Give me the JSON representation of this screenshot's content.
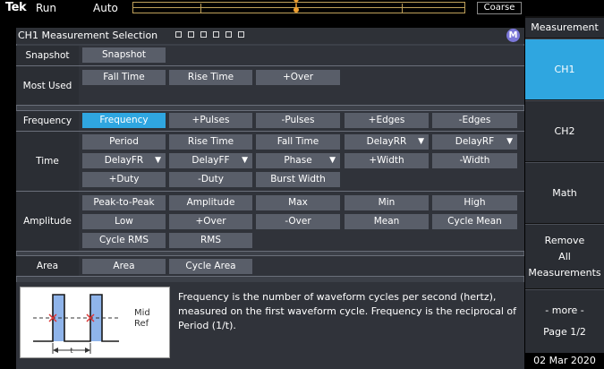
{
  "topbar": {
    "brand": "Tek",
    "run_status": "Run",
    "trigger_mode": "Auto",
    "scale_mode": "Coarse"
  },
  "panel": {
    "title": "CH1 Measurement Selection",
    "badge": "M"
  },
  "categories": {
    "snapshot": "Snapshot",
    "most_used": "Most Used",
    "frequency": "Frequency",
    "time": "Time",
    "amplitude": "Amplitude",
    "area": "Area"
  },
  "buttons": {
    "snapshot": [
      "Snapshot"
    ],
    "most_used": [
      "Fall Time",
      "Rise Time",
      "+Over"
    ],
    "frequency": [
      "Frequency",
      "+Pulses",
      "-Pulses",
      "+Edges",
      "-Edges"
    ],
    "time_row1": [
      "Period",
      "Rise Time",
      "Fall Time",
      "DelayRR",
      "DelayRF"
    ],
    "time_row2": [
      "DelayFR",
      "DelayFF",
      "Phase",
      "+Width",
      "-Width"
    ],
    "time_row3": [
      "+Duty",
      "-Duty",
      "Burst Width"
    ],
    "amp_row1": [
      "Peak-to-Peak",
      "Amplitude",
      "Max",
      "Min",
      "High"
    ],
    "amp_row2": [
      "Low",
      "+Over",
      "-Over",
      "Mean",
      "Cycle Mean"
    ],
    "amp_row3": [
      "Cycle RMS",
      "RMS"
    ],
    "area": [
      "Area",
      "Cycle Area"
    ]
  },
  "description": {
    "text": "Frequency is the number of waveform cycles per second (hertz), measured on the first waveform cycle. Frequency is the reciprocal of Period (1/t).",
    "diagram_mid_label": "Mid",
    "diagram_ref_label": "Ref",
    "diagram_t_label": "t"
  },
  "side_menu": {
    "title": "Measurement",
    "ch1": "CH1",
    "ch2": "CH2",
    "math": "Math",
    "remove_line1": "Remove",
    "remove_line2": "All",
    "remove_line3": "Measurements",
    "more": "- more -",
    "page": "Page 1/2"
  },
  "status": {
    "date": "02 Mar 2020"
  },
  "colors": {
    "accent": "#2fa6e0",
    "badge": "#7b77d8",
    "button": "#595e69",
    "trigger": "#f0a030"
  }
}
